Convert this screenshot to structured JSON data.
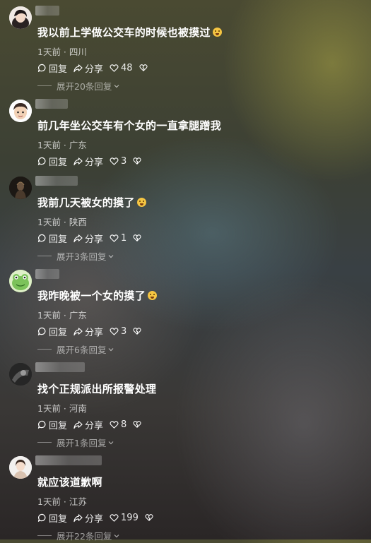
{
  "comments": [
    {
      "text": "我以前上学做公交车的时候也被摸过",
      "emoji": "crying-face-emoji",
      "time": "1天前",
      "location": "四川",
      "reply_label": "回复",
      "share_label": "分享",
      "likes": "48",
      "expand_text": "展开20条回复",
      "avatar": "avatar-girl-dark-hair"
    },
    {
      "text": "前几年坐公交车有个女的一直拿腿蹭我",
      "time": "1天前",
      "location": "广东",
      "reply_label": "回复",
      "share_label": "分享",
      "likes": "3",
      "avatar": "avatar-cartoon-boy"
    },
    {
      "text": "我前几天被女的摸了",
      "emoji": "surprised-face-emoji",
      "time": "1天前",
      "location": "陕西",
      "reply_label": "回复",
      "share_label": "分享",
      "likes": "1",
      "expand_text": "展开3条回复",
      "avatar": "avatar-dark-figure"
    },
    {
      "text": "我昨晚被一个女的摸了",
      "emoji": "crying-face-emoji",
      "time": "1天前",
      "location": "广东",
      "reply_label": "回复",
      "share_label": "分享",
      "likes": "3",
      "expand_text": "展开6条回复",
      "avatar": "avatar-green-frog"
    },
    {
      "text": "找个正规派出所报警处理",
      "time": "1天前",
      "location": "河南",
      "reply_label": "回复",
      "share_label": "分享",
      "likes": "8",
      "expand_text": "展开1条回复",
      "avatar": "avatar-dark-photo"
    },
    {
      "text": "就应该道歉啊",
      "time": "1天前",
      "location": "江苏",
      "reply_label": "回复",
      "share_label": "分享",
      "likes": "199",
      "expand_text": "展开22条回复",
      "avatar": "avatar-woman-portrait"
    }
  ],
  "meta_separator": " · ",
  "colors": {
    "text": "#ffffff",
    "meta": "#b8b8b8",
    "emoji": "#f5c542"
  }
}
